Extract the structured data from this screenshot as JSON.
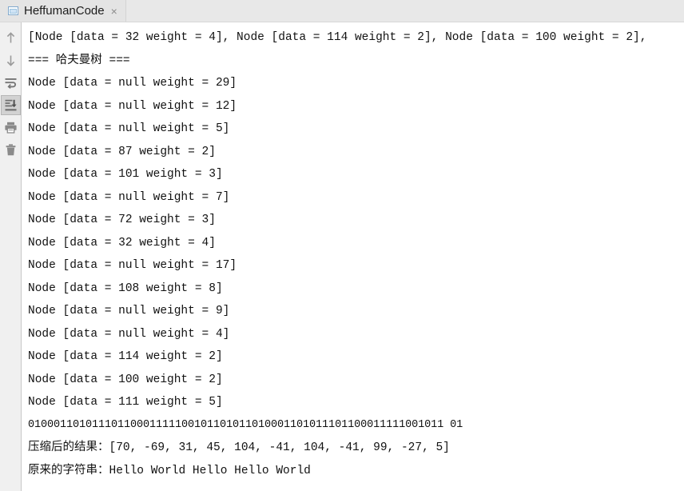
{
  "window": {
    "tab": {
      "title": "HeffumanCode",
      "close_label": "×",
      "icon": "java-class-file-icon"
    }
  },
  "toolbar": {
    "buttons": [
      {
        "name": "up-arrow-icon",
        "label": "Up",
        "selected": false
      },
      {
        "name": "down-arrow-icon",
        "label": "Down",
        "selected": false
      },
      {
        "name": "soft-wrap-icon",
        "label": "Soft-Wrap",
        "selected": false
      },
      {
        "name": "scroll-to-end-icon",
        "label": "Scroll to End",
        "selected": true
      },
      {
        "name": "print-icon",
        "label": "Print",
        "selected": false
      },
      {
        "name": "trash-icon",
        "label": "Clear All",
        "selected": false
      }
    ]
  },
  "console": {
    "lines": [
      {
        "id": "line-node-array",
        "text": "[Node [data = 32 weight = 4], Node [data = 114 weight = 2], Node [data = 100 weight = 2],",
        "style": "code"
      },
      {
        "id": "line-header",
        "text": "=== 哈夫曼树 ===",
        "style": "cn"
      },
      {
        "id": "line-node-1",
        "text": "Node [data = null weight = 29]",
        "style": "code"
      },
      {
        "id": "line-node-2",
        "text": "Node [data = null weight = 12]",
        "style": "code"
      },
      {
        "id": "line-node-3",
        "text": "Node [data = null weight = 5]",
        "style": "code"
      },
      {
        "id": "line-node-4",
        "text": "Node [data = 87 weight = 2]",
        "style": "code"
      },
      {
        "id": "line-node-5",
        "text": "Node [data = 101 weight = 3]",
        "style": "code"
      },
      {
        "id": "line-node-6",
        "text": "Node [data = null weight = 7]",
        "style": "code"
      },
      {
        "id": "line-node-7",
        "text": "Node [data = 72 weight = 3]",
        "style": "code"
      },
      {
        "id": "line-node-8",
        "text": "Node [data = 32 weight = 4]",
        "style": "code"
      },
      {
        "id": "line-node-9",
        "text": "Node [data = null weight = 17]",
        "style": "code"
      },
      {
        "id": "line-node-10",
        "text": "Node [data = 108 weight = 8]",
        "style": "code"
      },
      {
        "id": "line-node-11",
        "text": "Node [data = null weight = 9]",
        "style": "code"
      },
      {
        "id": "line-node-12",
        "text": "Node [data = null weight = 4]",
        "style": "code"
      },
      {
        "id": "line-node-13",
        "text": "Node [data = 114 weight = 2]",
        "style": "code"
      },
      {
        "id": "line-node-14",
        "text": "Node [data = 100 weight = 2]",
        "style": "code"
      },
      {
        "id": "line-node-15",
        "text": "Node [data = 111 weight = 5]",
        "style": "code"
      },
      {
        "id": "line-bits",
        "text": "01000110101110110001111100101101011010001101011101100011111001011 01",
        "style": "binary"
      },
      {
        "id": "line-compressed",
        "text": "压缩后的结果：[70, -69, 31, 45, 104, -41, 104, -41, 99, -27, 5]",
        "style": "cn"
      },
      {
        "id": "line-original",
        "text": "原来的字符串：Hello World Hello Hello World",
        "style": "cn"
      }
    ],
    "huffman_bits": "0100011010111011000111110010110101101000110101110110001111100101101",
    "compressed_bytes": [
      70,
      -69,
      31,
      45,
      104,
      -41,
      104,
      -41,
      99,
      -27,
      5
    ],
    "original_string": "Hello World Hello Hello World"
  },
  "colors": {
    "tabbar_bg": "#e8e8e8",
    "tab_bg": "#e2e2e2",
    "toolbar_bg": "#f0f0f0",
    "console_bg": "#ffffff",
    "text": "#111111",
    "icon_gray": "#8d8d8d",
    "selected_bg": "#d2d2d2"
  }
}
